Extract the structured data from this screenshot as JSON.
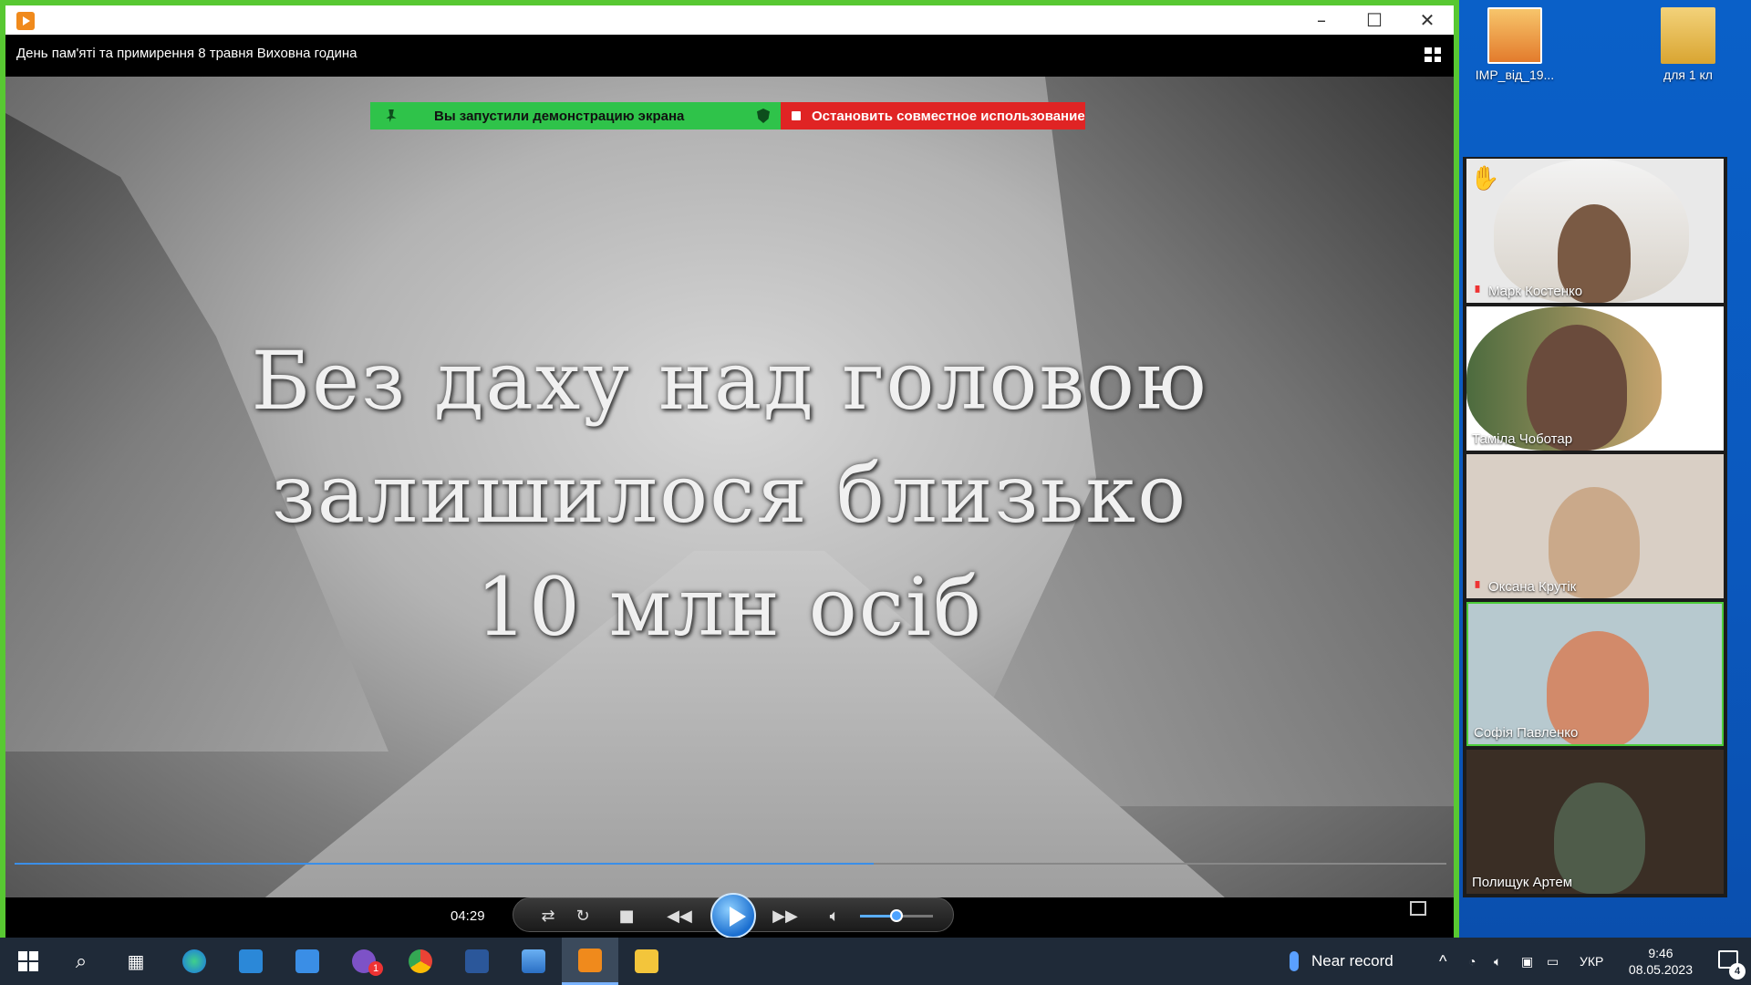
{
  "desktop": {
    "icons": [
      {
        "label": "IMP_від_19...",
        "icon": "pdf-icon"
      },
      {
        "label": "для 1 кл",
        "icon": "folder-icon"
      }
    ]
  },
  "player": {
    "video_title": "День пам'яті та примирення 8 травня Виховна година",
    "caption_lines": [
      "Без даху над головою",
      "залишилося близько",
      "10 млн осіб"
    ],
    "progress_fraction": 0.6,
    "time": "04:29",
    "volume_fraction": 0.5
  },
  "share_bar": {
    "status_text": "Вы запустили демонстрацию экрана",
    "stop_label": "Остановить совместное использование",
    "colors": {
      "green": "#2fc34a",
      "red": "#e02424"
    }
  },
  "participants": [
    {
      "name": "Марк Костенко",
      "muted": true,
      "hand_raised": true,
      "active": false
    },
    {
      "name": "Таміла Чоботар",
      "muted": false,
      "hand_raised": false,
      "active": false
    },
    {
      "name": "Оксана Крутік",
      "muted": true,
      "hand_raised": false,
      "active": false
    },
    {
      "name": "Софія  Павленко",
      "muted": false,
      "hand_raised": false,
      "active": true
    },
    {
      "name": "Полищук Артем",
      "muted": false,
      "hand_raised": false,
      "active": false
    }
  ],
  "taskbar": {
    "tray_weather": "Near record",
    "language": "УКР",
    "time": "9:46",
    "date": "08.05.2023",
    "notification_count": "4",
    "viber_badge": "1"
  },
  "accent_color": "#58c832"
}
